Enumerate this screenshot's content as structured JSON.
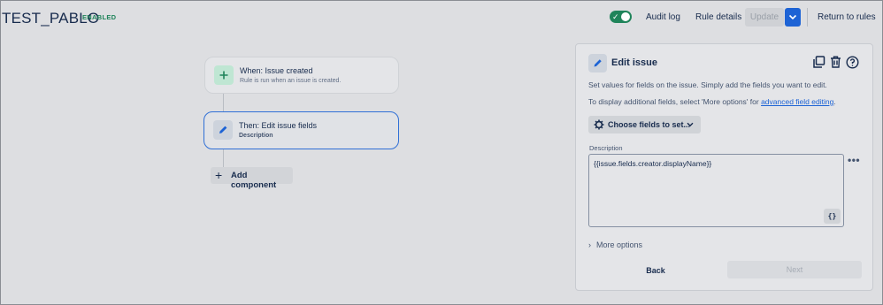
{
  "header": {
    "rule_name": "TEST_PABLO",
    "status_badge": "ENABLED",
    "audit_log": "Audit log",
    "rule_details": "Rule details",
    "update": "Update",
    "return_to_rules": "Return to rules",
    "toggle_on": true
  },
  "flow": {
    "trigger": {
      "title": "When: Issue created",
      "subtitle": "Rule is run when an issue is created.",
      "icon": "plus-icon"
    },
    "action": {
      "title": "Then: Edit issue fields",
      "subtitle": "Description",
      "icon": "pencil-icon"
    },
    "add_component": "Add component"
  },
  "panel": {
    "title": "Edit issue",
    "icon": "pencil-icon",
    "desc1": "Set values for fields on the issue. Simply add the fields you want to edit.",
    "desc2_prefix": "To display additional fields, select 'More options' for ",
    "desc2_link": "advanced field editing",
    "desc2_suffix": ".",
    "choose_fields": "Choose fields to set...",
    "field_label": "Description",
    "field_value": "{{issue.fields.creator.displayName}}",
    "smart_values_button": "{}",
    "more_options": "More options",
    "back": "Back",
    "next": "Next"
  },
  "colors": {
    "accent": "#1d63d5",
    "success": "#1f845a",
    "background": "#dddee1"
  }
}
